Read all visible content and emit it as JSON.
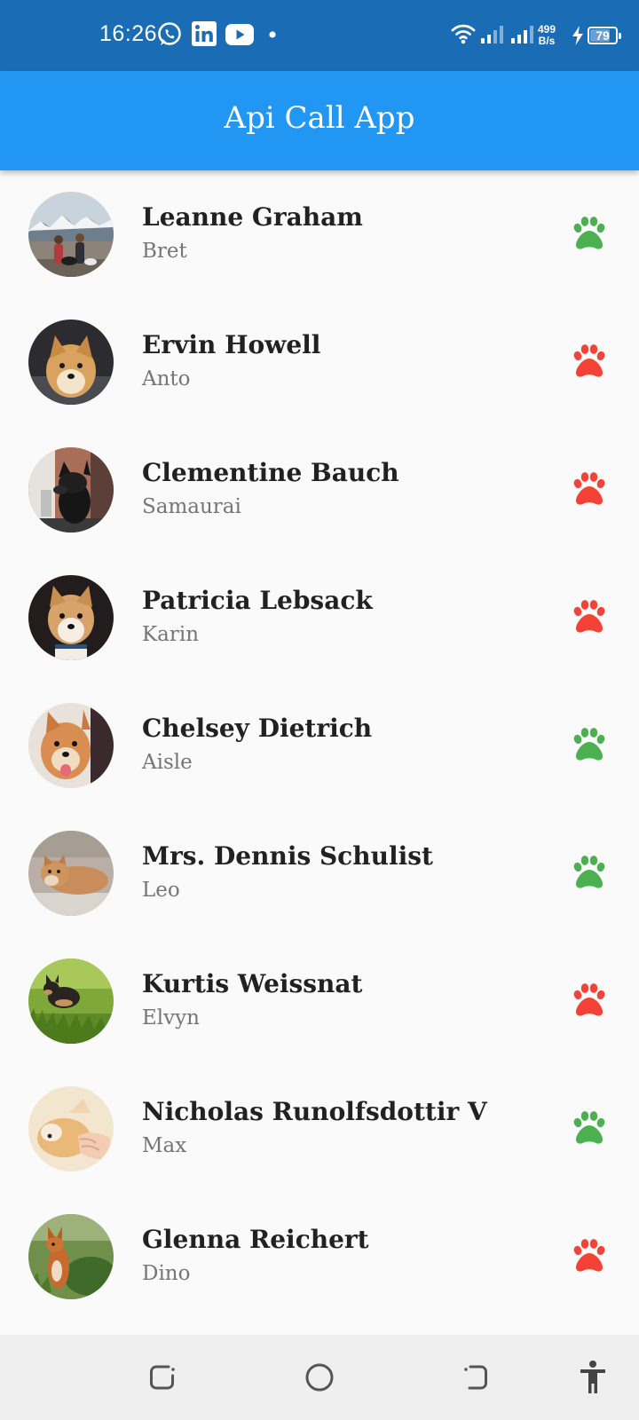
{
  "status_bar": {
    "time": "16:26",
    "net_speed_value": "499",
    "net_speed_unit": "B/s",
    "battery": "79",
    "battery_level": 0.79,
    "notification_icons": [
      "whatsapp-icon",
      "linkedin-icon",
      "youtube-icon",
      "dot-icon"
    ],
    "system_icons": [
      "wifi-icon",
      "signal-icon",
      "signal-icon",
      "charging-icon",
      "battery-icon"
    ]
  },
  "app_bar": {
    "title": "Api Call App",
    "color": "#2196F3"
  },
  "colors": {
    "status_bar": "#1A6DB5",
    "paw_green": "#4CAF50",
    "paw_red": "#F44336",
    "name_text": "#212121",
    "username_text": "#757575",
    "nav_bar": "#EFEFEF"
  },
  "users": [
    {
      "name": "Leanne Graham",
      "username": "Bret",
      "status": "green",
      "icon": "paw-icon"
    },
    {
      "name": "Ervin Howell",
      "username": "Anto",
      "status": "red",
      "icon": "paw-icon"
    },
    {
      "name": "Clementine Bauch",
      "username": "Samaurai",
      "status": "red",
      "icon": "paw-icon"
    },
    {
      "name": "Patricia Lebsack",
      "username": "Karin",
      "status": "red",
      "icon": "paw-icon"
    },
    {
      "name": "Chelsey Dietrich",
      "username": "Aisle",
      "status": "green",
      "icon": "paw-icon"
    },
    {
      "name": "Mrs. Dennis Schulist",
      "username": "Leo",
      "status": "green",
      "icon": "paw-icon"
    },
    {
      "name": "Kurtis Weissnat",
      "username": "Elvyn",
      "status": "red",
      "icon": "paw-icon"
    },
    {
      "name": "Nicholas Runolfsdottir V",
      "username": "Max",
      "status": "green",
      "icon": "paw-icon"
    },
    {
      "name": "Glenna Reichert",
      "username": "Dino",
      "status": "red",
      "icon": "paw-icon"
    }
  ],
  "nav_bar": {
    "buttons": [
      "recents-icon",
      "home-icon",
      "back-icon",
      "accessibility-icon"
    ]
  }
}
